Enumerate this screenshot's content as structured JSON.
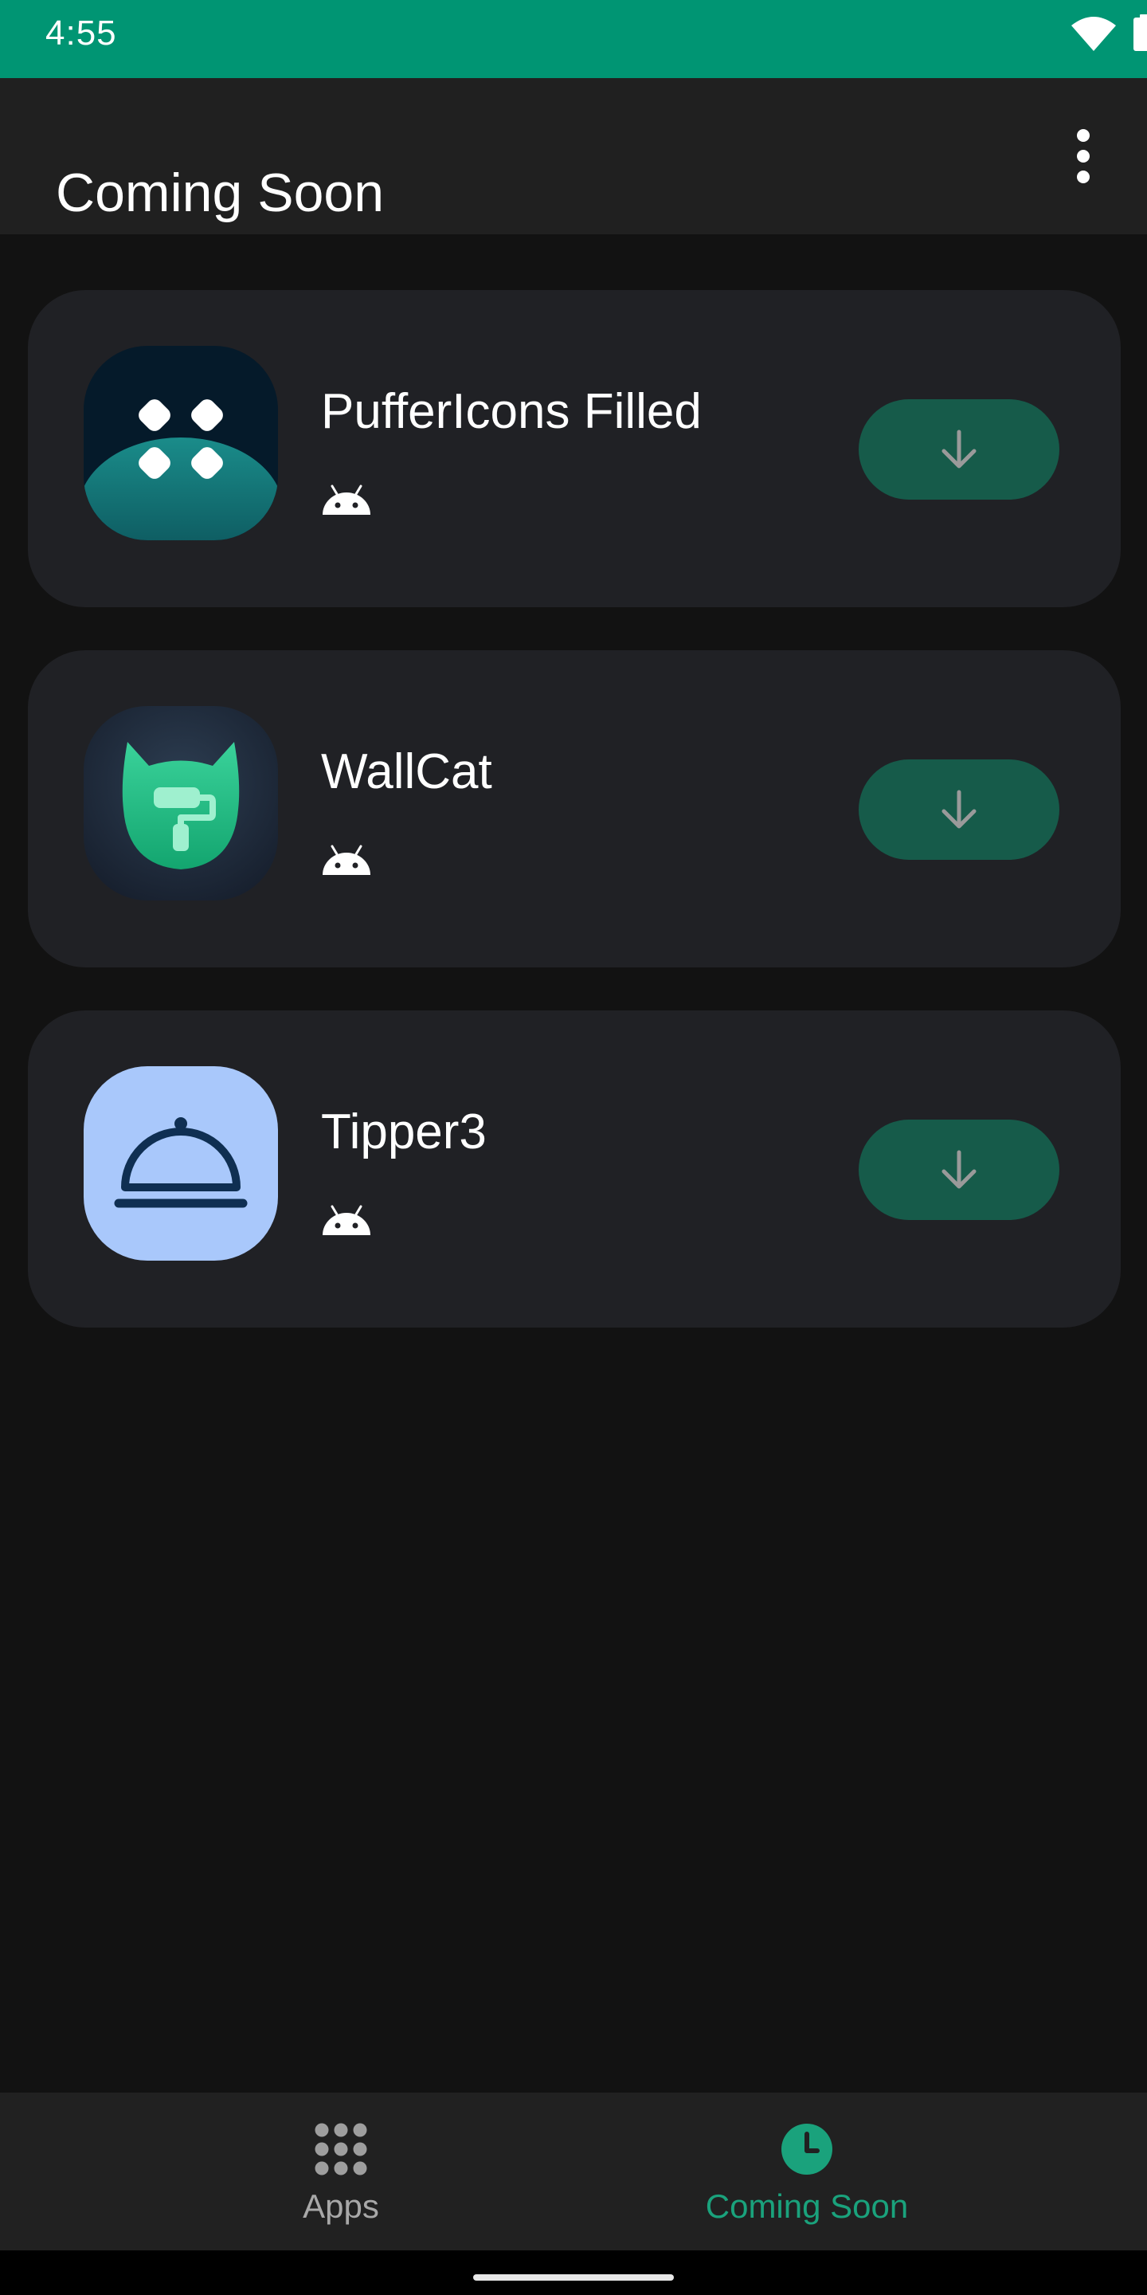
{
  "status_bar": {
    "time": "4:55",
    "icons": [
      "wifi-icon",
      "battery-icon"
    ],
    "color": "#009573"
  },
  "app_bar": {
    "title": "Coming Soon",
    "menu_icon": "more-vert-icon"
  },
  "apps": [
    {
      "name": "PufferIcons Filled",
      "icon": "puffericons-app-icon",
      "platform_icon": "android-icon",
      "action_icon": "download-icon"
    },
    {
      "name": "WallCat",
      "icon": "wallcat-app-icon",
      "platform_icon": "android-icon",
      "action_icon": "download-icon"
    },
    {
      "name": "Tipper3",
      "icon": "tipper3-app-icon",
      "platform_icon": "android-icon",
      "action_icon": "download-icon"
    }
  ],
  "bottom_nav": {
    "items": [
      {
        "label": "Apps",
        "icon": "apps-grid-icon",
        "selected": false
      },
      {
        "label": "Coming Soon",
        "icon": "clock-icon",
        "selected": true
      }
    ],
    "accent_color": "#1aa27c",
    "inactive_color": "#a8a8a8"
  },
  "colors": {
    "background": "#121212",
    "card": "#202125",
    "download_button": "#165b4a"
  }
}
